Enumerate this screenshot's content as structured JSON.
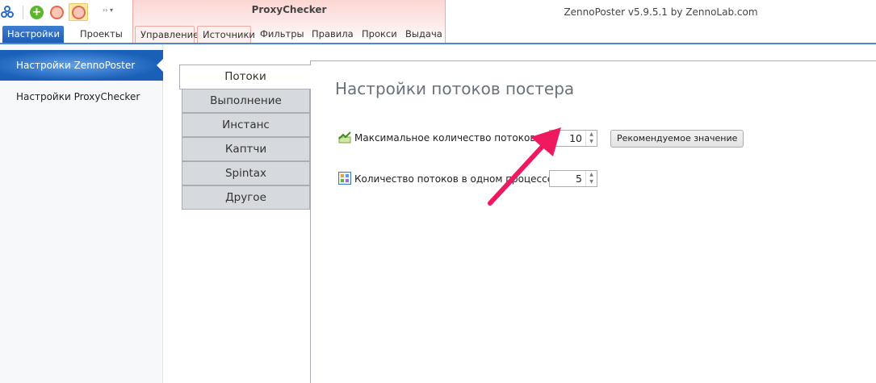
{
  "app_title": "ZennoPoster v5.9.5.1 by ZennoLab.com",
  "ribbon": {
    "context_title": "ProxyChecker",
    "tabs": [
      {
        "label": "Настройки"
      },
      {
        "label": "Проекты"
      },
      {
        "label": "Управление"
      },
      {
        "label": "Источники"
      },
      {
        "label": "Фильтры"
      },
      {
        "label": "Правила"
      },
      {
        "label": "Прокси"
      },
      {
        "label": "Выдача"
      }
    ],
    "quick_access": [
      "app-logo-icon",
      "add-icon",
      "play-icon",
      "stop-icon",
      "more-icon"
    ]
  },
  "sidebar": {
    "items": [
      {
        "label": "Настройки ZennoPoster",
        "selected": true
      },
      {
        "label": "Настройки ProxyChecker"
      }
    ]
  },
  "vtabs": [
    {
      "label": "Потоки"
    },
    {
      "label": "Выполнение"
    },
    {
      "label": "Инстанс"
    },
    {
      "label": "Каптчи"
    },
    {
      "label": "Spintax"
    },
    {
      "label": "Другое"
    }
  ],
  "main": {
    "heading": "Настройки потоков постера",
    "max_threads": {
      "label": "Максимальное количество потоков",
      "value": "10"
    },
    "recommended_button": "Рекомендуемое значение",
    "threads_per_process": {
      "label": "Количество потоков в одном процессе",
      "value": "5"
    }
  },
  "annotation_color": "#f0195f"
}
